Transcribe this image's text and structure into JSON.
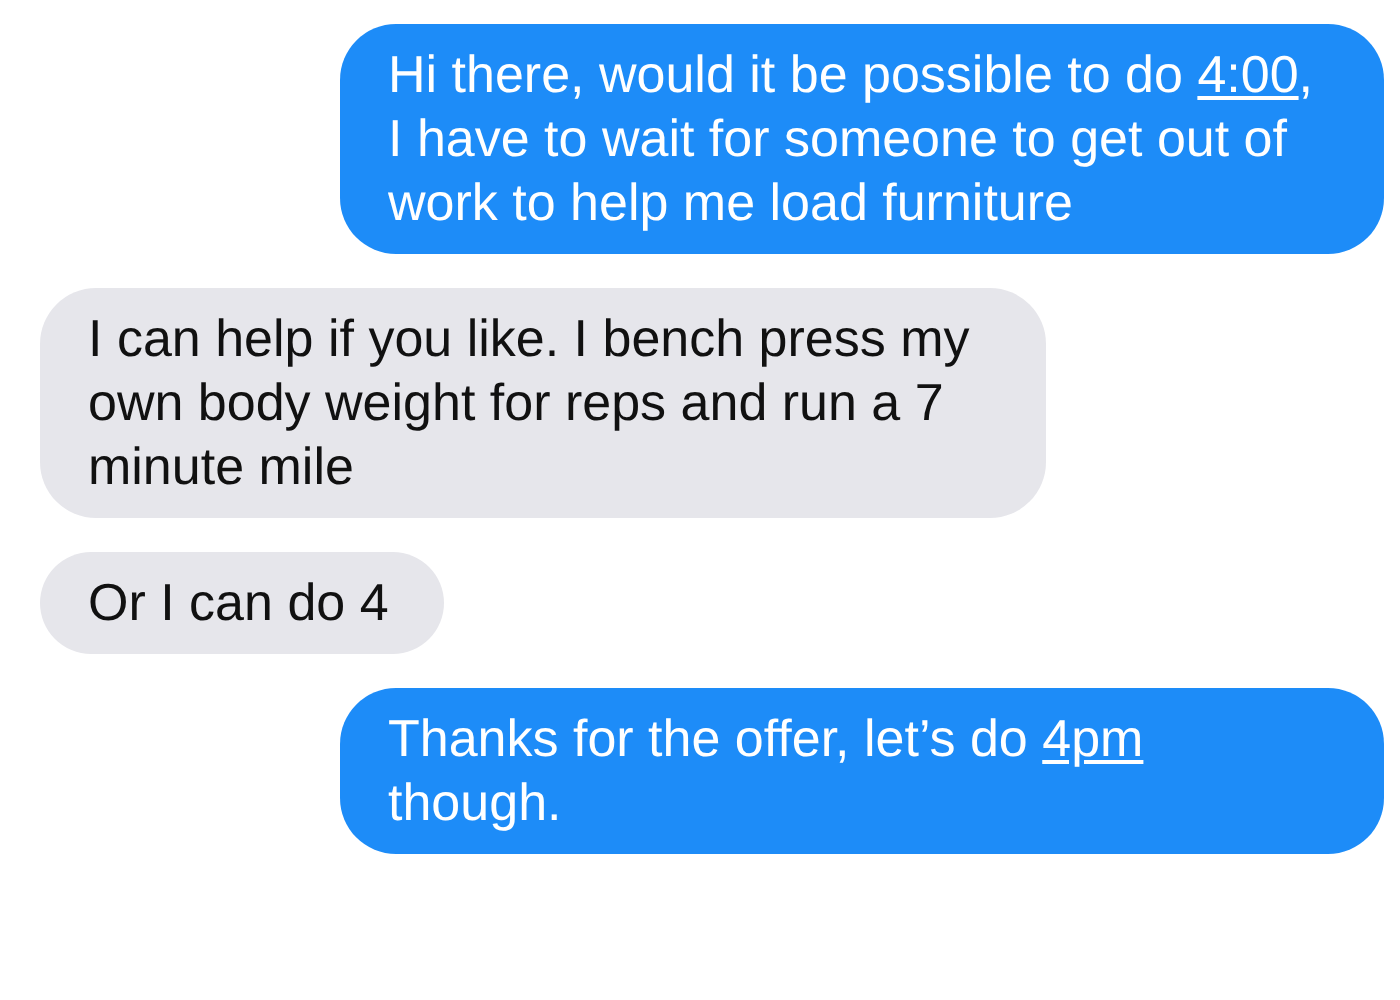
{
  "messages": [
    {
      "kind": "sent",
      "parts": [
        {
          "text": "Hi there, would it be possible to do "
        },
        {
          "text": "4:00",
          "link": true
        },
        {
          "text": ", I have to wait for someone to get out of work to help me load furniture"
        }
      ]
    },
    {
      "kind": "received",
      "parts": [
        {
          "text": "I can help if you like. I bench press my own body weight for reps and run a 7 minute mile"
        }
      ]
    },
    {
      "kind": "received",
      "parts": [
        {
          "text": "Or I can do 4"
        }
      ]
    },
    {
      "kind": "sent",
      "parts": [
        {
          "text": "Thanks for the offer, let’s do "
        },
        {
          "text": "4pm",
          "link": true
        },
        {
          "text": " though."
        }
      ]
    }
  ]
}
